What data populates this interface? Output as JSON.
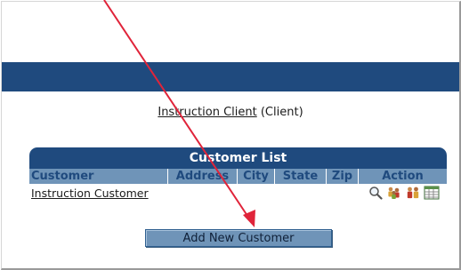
{
  "client": {
    "link_label": "Instruction Client",
    "suffix": "(Client)"
  },
  "customer_list": {
    "title": "Customer List",
    "columns": [
      "Customer",
      "Address",
      "City",
      "State",
      "Zip",
      "Action"
    ],
    "rows": [
      {
        "customer": "Instruction Customer",
        "address": "",
        "city": "",
        "state": "",
        "zip": ""
      }
    ],
    "action_icons": [
      "magnifier-icon",
      "users-group-icon",
      "users-pair-icon",
      "grid-icon"
    ]
  },
  "buttons": {
    "add_new_customer": "Add New Customer"
  },
  "colors": {
    "header_navy": "#1f4a7e",
    "column_header_blue": "#6f94b8",
    "annotation_arrow": "#e0243a"
  }
}
